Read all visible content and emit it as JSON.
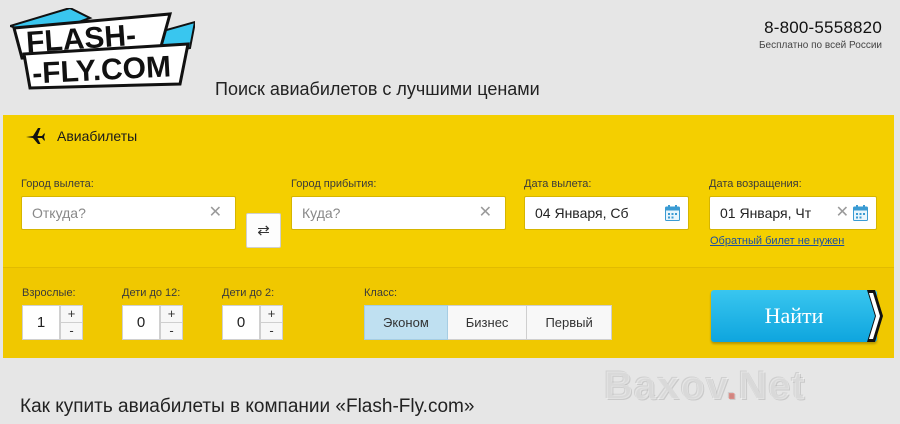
{
  "header": {
    "logo_line1": "FLASH-",
    "logo_line2": "-FLY.COM",
    "phone": "8-800-5558820",
    "phone_note": "Бесплатно по всей России",
    "tagline": "Поиск авиабилетов с лучшими ценами"
  },
  "search": {
    "tab_label": "Авиабилеты",
    "from": {
      "label": "Город вылета:",
      "placeholder": "Откуда?",
      "value": ""
    },
    "to": {
      "label": "Город прибытия:",
      "placeholder": "Куда?",
      "value": ""
    },
    "depart": {
      "label": "Дата вылета:",
      "value": "04 Января, Сб"
    },
    "return": {
      "label": "Дата возращения:",
      "value": "01 Января, Чт"
    },
    "swap_symbol": "⇄",
    "oneway_link": "Обратный билет не нужен",
    "adults": {
      "label": "Взрослые:",
      "value": "1"
    },
    "children12": {
      "label": "Дети до 12:",
      "value": "0"
    },
    "infants2": {
      "label": "Дети до 2:",
      "value": "0"
    },
    "plus": "+",
    "minus": "-",
    "class_label": "Класс:",
    "classes": [
      "Эконом",
      "Бизнес",
      "Первый"
    ],
    "selected_class": "Эконом",
    "submit": "Найти"
  },
  "content": {
    "how_to_buy": "Как купить авиабилеты в компании «Flash-Fly.com»"
  },
  "watermark": {
    "main": "Baxov",
    "dot": ".",
    "tld": "Net"
  },
  "icons": {
    "plane": "plane-icon",
    "clear": "close-icon",
    "calendar": "calendar-icon"
  },
  "colors": {
    "panel": "#f4cf00",
    "button": "#1aaee3",
    "active_class": "#bfe0f1",
    "link": "#1a4ea0"
  }
}
